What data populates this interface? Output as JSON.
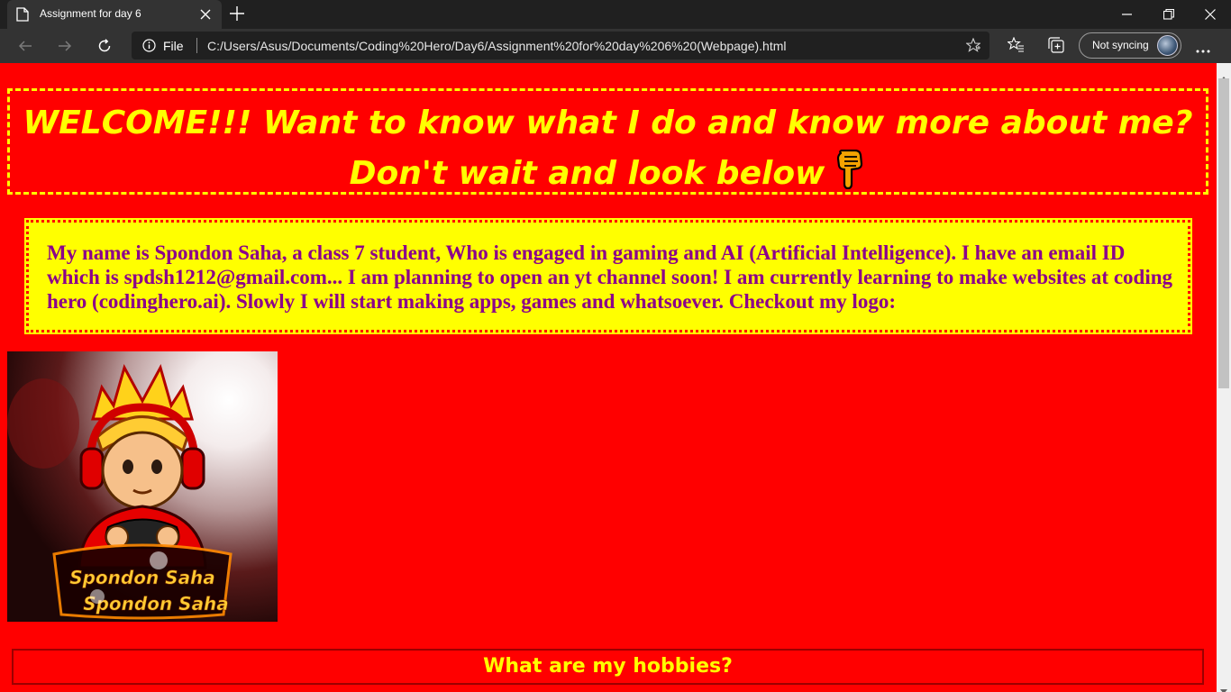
{
  "tab": {
    "title": "Assignment for day 6"
  },
  "address": {
    "scheme_label": "File",
    "url": "C:/Users/Asus/Documents/Coding%20Hero/Day6/Assignment%20for%20day%206%20(Webpage).html"
  },
  "profile": {
    "sync_label": "Not syncing"
  },
  "page": {
    "welcome_line1": "WELCOME!!! Want to know what I do and know more about me?",
    "welcome_line2": "Don't wait and look below",
    "intro": "My name is Spondon Saha, a class 7 student, Who is engaged in gaming and AI (Artificial Intelligence). I have an email ID which is spdsh1212@gmail.com... I am planning to open an yt channel soon! I am currently learning to make websites at coding hero (codinghero.ai). Slowly I will start making apps, games and whatsoever. Checkout my logo:",
    "logo_text_top": "Spondon Saha",
    "logo_text_bottom": "Spondon Saha",
    "hobbies_heading": "What are my hobbies?"
  },
  "colors": {
    "page_bg": "#ff0000",
    "heading_yellow": "#ffff00",
    "intro_text": "#8b008b",
    "chrome_dark": "#202020",
    "chrome_toolbar": "#333333"
  },
  "icons": {
    "tab": [
      "page-icon",
      "close-icon",
      "new-tab-icon"
    ],
    "window": [
      "minimize-icon",
      "restore-icon",
      "close-window-icon"
    ],
    "toolbar": [
      "back-arrow-icon",
      "forward-arrow-icon",
      "refresh-icon",
      "info-icon",
      "star-icon",
      "favorites-icon",
      "collections-icon",
      "more-icon"
    ],
    "page": [
      "pointing-down-hand-icon"
    ]
  }
}
